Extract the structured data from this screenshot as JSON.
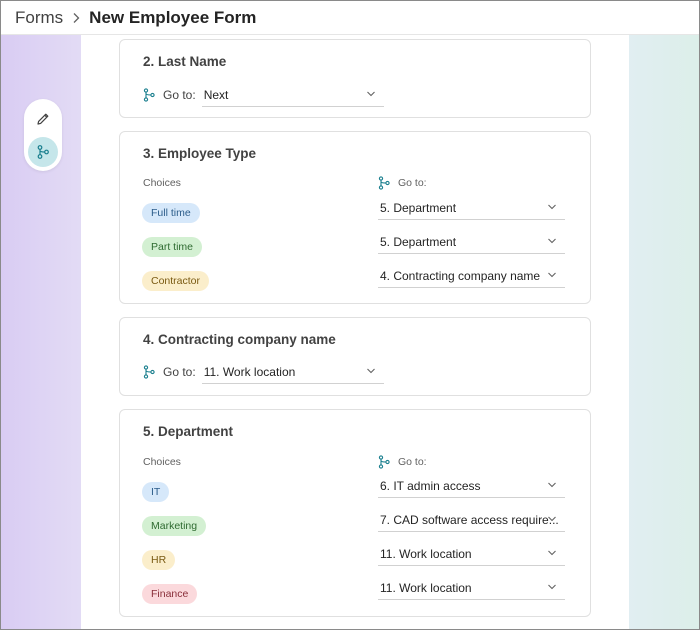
{
  "breadcrumb": {
    "root": "Forms",
    "current": "New Employee Form"
  },
  "toolbar": {
    "edit_icon": "pencil-icon",
    "branch_icon": "branching-icon"
  },
  "colors": {
    "accent": "#1a7f8e",
    "branch_active_bg": "#c5e6ea"
  },
  "questions": [
    {
      "title": "2. Last Name",
      "goto_label": "Go to:",
      "goto_value": "Next"
    },
    {
      "title": "3. Employee Type",
      "choices_label": "Choices",
      "goto_label": "Go to:",
      "rows": [
        {
          "choice": "Full time",
          "goto": "5. Department",
          "pill_bg": "#d6e8fa",
          "pill_fg": "#2c5d8a"
        },
        {
          "choice": "Part time",
          "goto": "5. Department",
          "pill_bg": "#d3f0d2",
          "pill_fg": "#2f6b31"
        },
        {
          "choice": "Contractor",
          "goto": "4. Contracting company name",
          "pill_bg": "#fbeecb",
          "pill_fg": "#7a5a12"
        }
      ]
    },
    {
      "title": "4. Contracting company name",
      "goto_label": "Go to:",
      "goto_value": "11. Work location"
    },
    {
      "title": "5. Department",
      "choices_label": "Choices",
      "goto_label": "Go to:",
      "rows": [
        {
          "choice": "IT",
          "goto": "6. IT admin access",
          "pill_bg": "#d6e8fa",
          "pill_fg": "#2c5d8a"
        },
        {
          "choice": "Marketing",
          "goto": "7. CAD software access require...",
          "pill_bg": "#d3f0d2",
          "pill_fg": "#2f6b31"
        },
        {
          "choice": "HR",
          "goto": "11. Work location",
          "pill_bg": "#fbeecb",
          "pill_fg": "#7a5a12"
        },
        {
          "choice": "Finance",
          "goto": "11. Work location",
          "pill_bg": "#fbd9dc",
          "pill_fg": "#8a2f3a"
        }
      ]
    }
  ]
}
